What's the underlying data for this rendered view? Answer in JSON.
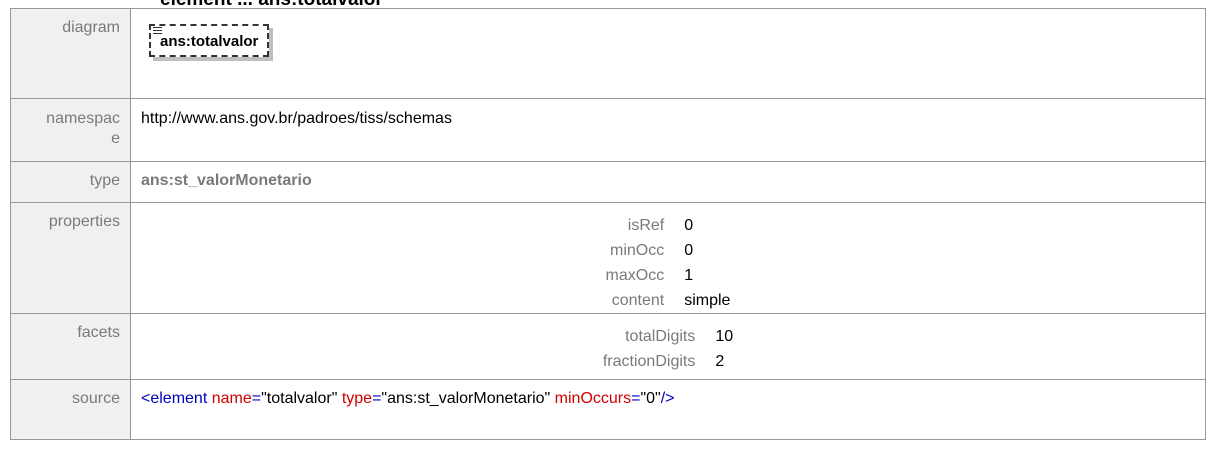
{
  "heading": "element ... ans:totalvalor",
  "rows": {
    "diagram": {
      "label": "diagram",
      "element_name": "ans:totalvalor"
    },
    "namespace": {
      "label_line1": "namespac",
      "label_line2": "e",
      "value": "http://www.ans.gov.br/padroes/tiss/schemas"
    },
    "type": {
      "label": "type",
      "value": "ans:st_valorMonetario"
    },
    "properties": {
      "label": "properties",
      "items": [
        {
          "key": "isRef",
          "value": "0"
        },
        {
          "key": "minOcc",
          "value": "0"
        },
        {
          "key": "maxOcc",
          "value": "1"
        },
        {
          "key": "content",
          "value": "simple"
        }
      ]
    },
    "facets": {
      "label": "facets",
      "items": [
        {
          "key": "totalDigits",
          "value": "10"
        },
        {
          "key": "fractionDigits",
          "value": "2"
        }
      ]
    },
    "source": {
      "label": "source",
      "open": "<element",
      "attr1_name": "name",
      "attr1_value": "\"totalvalor\"",
      "attr2_name": "type",
      "attr2_value": "\"ans:st_valorMonetario\"",
      "attr3_name": "minOccurs",
      "attr3_value": "\"0\"",
      "close": "/>",
      "equals": "="
    }
  },
  "colors": {
    "label_bg": "#f0f0f0",
    "label_text": "#7a7a7a",
    "border": "#999999",
    "xml_tag": "#0000c0",
    "xml_attr": "#d00000"
  }
}
